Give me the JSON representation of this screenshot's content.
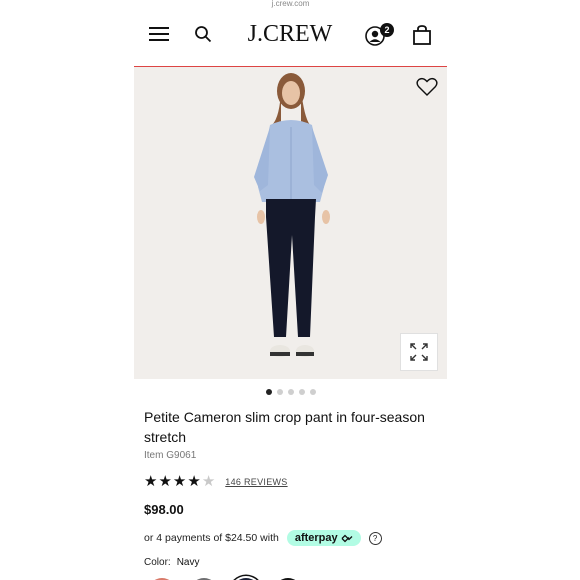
{
  "browser": {
    "url_fragment": "j.crew.com"
  },
  "header": {
    "logo": "J.CREW",
    "cart_badge_count": "2"
  },
  "gallery": {
    "dots_total": 5,
    "active_dot": 1,
    "background_color": "#f1eeeb"
  },
  "product": {
    "title": "Petite Cameron slim crop pant in four-season stretch",
    "item_number": "Item G9061",
    "rating": {
      "stars_filled": 4,
      "stars_total": 5,
      "reviews_label": "146 REVIEWS"
    },
    "price": "$98.00",
    "installments": {
      "text": "or 4 payments of $24.50 with",
      "provider": "afterpay",
      "help_symbol": "?"
    },
    "color": {
      "label": "Color:",
      "value": "Navy"
    }
  },
  "colors": {
    "accent_border": "#dd4444",
    "afterpay_green": "#b2fce4"
  },
  "icons": [
    "hamburger-menu-icon",
    "search-icon",
    "account-icon",
    "shopping-bag-icon",
    "heart-icon",
    "expand-icon",
    "help-icon",
    "afterpay-logo-icon"
  ]
}
